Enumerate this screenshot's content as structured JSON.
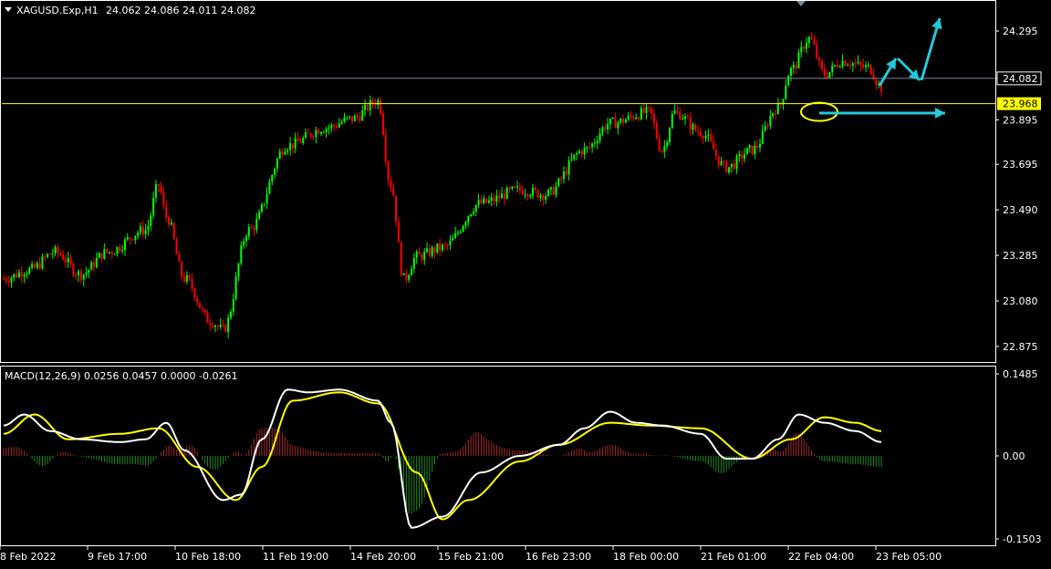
{
  "header": {
    "symbol": "XAGUSD.Exp,H1",
    "ohlc": "24.062 24.086 24.011 24.082"
  },
  "indicator": {
    "label": "MACD(12,26,9) 0.0256 0.0457 0.0000 -0.0261"
  },
  "colors": {
    "background": "#000000",
    "bull": "#00ff00",
    "bear": "#ff0000",
    "frame": "#ffffff",
    "price_line": "#778899",
    "support_line": "#ffff00",
    "macd_line": "#ffffff",
    "signal_line": "#ffff00",
    "hist_pos": "#a52a2a",
    "hist_neg": "#228b22",
    "arrow": "#22c9dc",
    "support_tag_bg": "#ffff00"
  },
  "chart_data": [
    {
      "type": "candlestick",
      "name": "price",
      "ylim": [
        22.77,
        24.42
      ],
      "y_ticks": [
        "24.295",
        "24.082",
        "23.895",
        "23.695",
        "23.490",
        "23.285",
        "23.080",
        "22.875"
      ],
      "current_price": "24.082",
      "support_level": "23.968",
      "anchors": [
        [
          0,
          23.18
        ],
        [
          10,
          23.22
        ],
        [
          20,
          23.3
        ],
        [
          30,
          23.2
        ],
        [
          40,
          23.3
        ],
        [
          55,
          23.4
        ],
        [
          60,
          23.6
        ],
        [
          63,
          23.46
        ],
        [
          70,
          23.18
        ],
        [
          80,
          22.99
        ],
        [
          85,
          22.95
        ],
        [
          95,
          23.4
        ],
        [
          110,
          23.78
        ],
        [
          125,
          23.86
        ],
        [
          135,
          23.9
        ],
        [
          145,
          23.98
        ],
        [
          150,
          23.6
        ],
        [
          155,
          23.18
        ],
        [
          160,
          23.28
        ],
        [
          170,
          23.32
        ],
        [
          185,
          23.52
        ],
        [
          200,
          23.58
        ],
        [
          210,
          23.56
        ],
        [
          225,
          23.76
        ],
        [
          235,
          23.88
        ],
        [
          250,
          23.93
        ],
        [
          255,
          23.76
        ],
        [
          260,
          23.93
        ],
        [
          270,
          23.84
        ],
        [
          280,
          23.68
        ],
        [
          290,
          23.76
        ],
        [
          300,
          23.95
        ],
        [
          305,
          24.12
        ],
        [
          312,
          24.26
        ],
        [
          318,
          24.1
        ],
        [
          325,
          24.16
        ],
        [
          335,
          24.13
        ],
        [
          340,
          24.04
        ]
      ],
      "x_tick_labels": [
        "8 Feb 2022",
        "9 Feb 17:00",
        "10 Feb 18:00",
        "11 Feb 19:00",
        "14 Feb 20:00",
        "15 Feb 21:00",
        "16 Feb 23:00",
        "18 Feb 00:00",
        "21 Feb 01:00",
        "22 Feb 04:00",
        "23 Feb 05:00"
      ]
    },
    {
      "type": "line",
      "name": "MACD",
      "ylim": [
        -0.1503,
        0.1485
      ],
      "y_ticks": [
        "0.1485",
        "0.00",
        "-0.1503"
      ],
      "macd_anchors": [
        [
          0,
          0.055
        ],
        [
          8,
          0.075
        ],
        [
          18,
          0.045
        ],
        [
          30,
          0.03
        ],
        [
          45,
          0.025
        ],
        [
          55,
          0.03
        ],
        [
          63,
          0.06
        ],
        [
          70,
          0.01
        ],
        [
          85,
          -0.08
        ],
        [
          92,
          -0.07
        ],
        [
          100,
          0.03
        ],
        [
          110,
          0.12
        ],
        [
          118,
          0.115
        ],
        [
          130,
          0.12
        ],
        [
          145,
          0.1
        ],
        [
          150,
          0.06
        ],
        [
          158,
          -0.13
        ],
        [
          170,
          -0.11
        ],
        [
          185,
          -0.03
        ],
        [
          200,
          0.0
        ],
        [
          215,
          0.02
        ],
        [
          225,
          0.05
        ],
        [
          235,
          0.08
        ],
        [
          245,
          0.06
        ],
        [
          255,
          0.055
        ],
        [
          270,
          0.04
        ],
        [
          280,
          -0.005
        ],
        [
          290,
          -0.005
        ],
        [
          300,
          0.03
        ],
        [
          308,
          0.075
        ],
        [
          318,
          0.06
        ],
        [
          330,
          0.045
        ],
        [
          340,
          0.025
        ]
      ],
      "signal_anchors": [
        [
          0,
          0.04
        ],
        [
          12,
          0.075
        ],
        [
          25,
          0.03
        ],
        [
          45,
          0.04
        ],
        [
          60,
          0.05
        ],
        [
          75,
          -0.02
        ],
        [
          90,
          -0.08
        ],
        [
          100,
          -0.02
        ],
        [
          112,
          0.1
        ],
        [
          130,
          0.115
        ],
        [
          145,
          0.095
        ],
        [
          160,
          -0.03
        ],
        [
          170,
          -0.115
        ],
        [
          180,
          -0.08
        ],
        [
          200,
          -0.01
        ],
        [
          215,
          0.02
        ],
        [
          235,
          0.06
        ],
        [
          250,
          0.055
        ],
        [
          270,
          0.05
        ],
        [
          290,
          -0.005
        ],
        [
          305,
          0.03
        ],
        [
          318,
          0.07
        ],
        [
          330,
          0.06
        ],
        [
          340,
          0.045
        ]
      ]
    }
  ]
}
